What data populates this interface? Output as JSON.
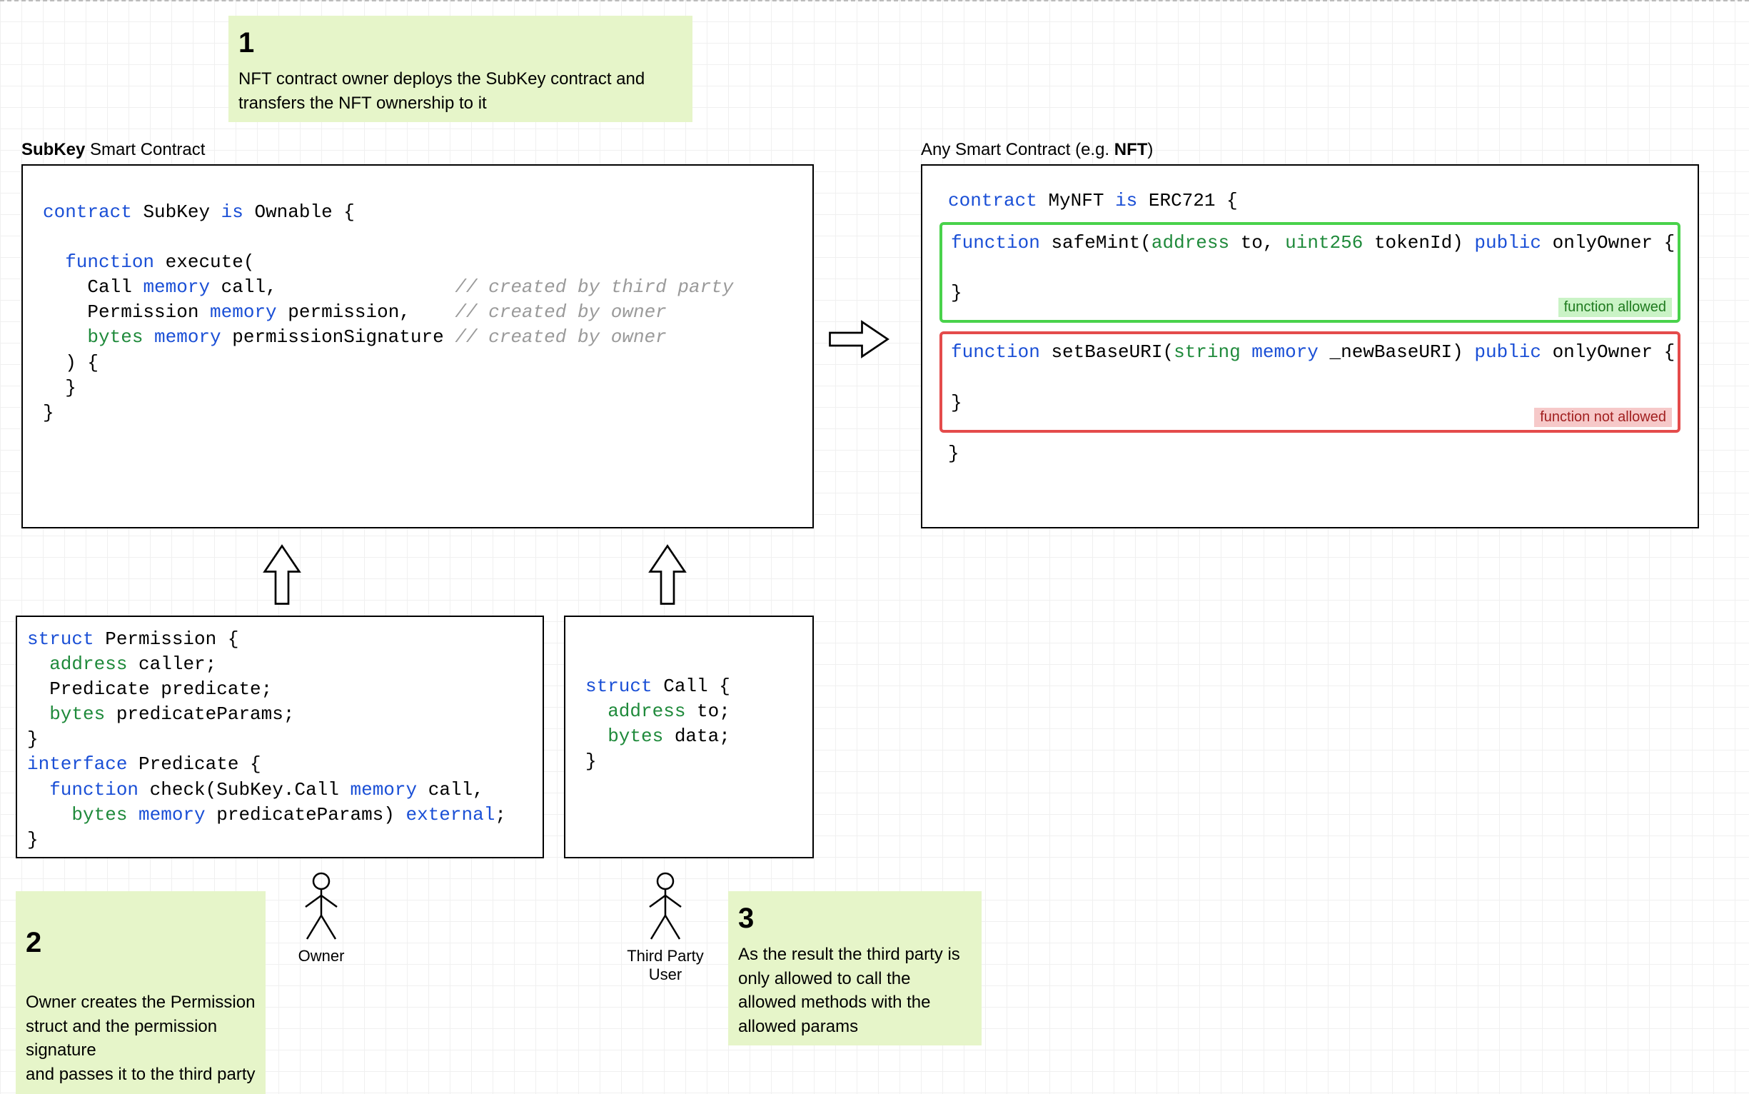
{
  "notes": {
    "n1": {
      "num": "1",
      "text": "NFT contract owner deploys the SubKey contract and transfers the NFT ownership to it"
    },
    "n2": {
      "num": "2",
      "text": "Owner creates the Permission struct and the permission signature\nand passes it to the third party"
    },
    "n3": {
      "num": "3",
      "text": "As the result the third party is only allowed to call the allowed methods with the allowed params"
    }
  },
  "labels": {
    "subkey_title_bold": "SubKey",
    "subkey_title_rest": " Smart Contract",
    "nft_title_pre": "Any Smart Contract (e.g. ",
    "nft_title_bold": "NFT",
    "nft_title_post": ")"
  },
  "code": {
    "subkey": {
      "l1a": "contract ",
      "l1b": "SubKey ",
      "l1c": "is ",
      "l1d": "Ownable {",
      "l2a": "  function ",
      "l2b": "execute(",
      "l3a": "    Call ",
      "l3b": "memory ",
      "l3c": "call,",
      "l3cm": "// created by third party",
      "l4a": "    Permission ",
      "l4b": "memory ",
      "l4c": "permission,",
      "l4cm": "// created by owner",
      "l5a": "    bytes ",
      "l5b": "memory ",
      "l5c": "permissionSignature ",
      "l5cm": "// created by owner",
      "l6": "  ) {",
      "l7": "  }",
      "l8": "}"
    },
    "perm": {
      "l1a": "struct ",
      "l1b": "Permission {",
      "l2a": "  address ",
      "l2b": "caller;",
      "l3a": "  Predicate predicate;",
      "l4a": "  bytes ",
      "l4b": "predicateParams;",
      "l5": "}",
      "l6a": "interface ",
      "l6b": "Predicate {",
      "l7a": "  function ",
      "l7b": "check(SubKey.Call ",
      "l7c": "memory ",
      "l7d": "call,",
      "l8a": "    bytes ",
      "l8b": "memory ",
      "l8c": "predicateParams) ",
      "l8d": "external",
      "l8e": ";",
      "l9": "}"
    },
    "call": {
      "l1a": "struct ",
      "l1b": "Call {",
      "l2a": "  address ",
      "l2b": "to;",
      "l3a": "  bytes ",
      "l3b": "data;",
      "l4": "}"
    },
    "nft": {
      "l1a": "contract ",
      "l1b": "MyNFT ",
      "l1c": "is ",
      "l1d": "ERC721 {",
      "mint_a": "function ",
      "mint_b": "safeMint(",
      "mint_c": "address ",
      "mint_d": "to, ",
      "mint_e": "uint256 ",
      "mint_f": "tokenId) ",
      "mint_g": "public ",
      "mint_h": "onlyOwner {",
      "mint_close": "}",
      "uri_a": "function ",
      "uri_b": "setBaseURI(",
      "uri_c": "string ",
      "uri_d": "memory ",
      "uri_e": "_newBaseURI) ",
      "uri_f": "public ",
      "uri_g": "onlyOwner {",
      "uri_close": "}",
      "end": "}"
    },
    "tags": {
      "allowed": "function allowed",
      "not_allowed": "function not allowed"
    }
  },
  "actors": {
    "owner": "Owner",
    "third": "Third Party User"
  }
}
